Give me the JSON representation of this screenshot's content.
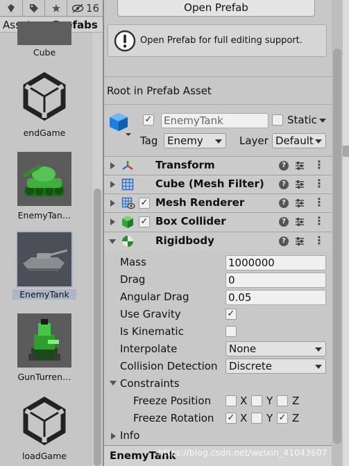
{
  "toolbar": {
    "icons": [
      "scene-icon",
      "tag-icon",
      "star-icon",
      "eye-hidden-icon"
    ],
    "hidden_count": "16"
  },
  "breadcrumb": {
    "root": "Assets",
    "separator": "▸",
    "current": "Prefabs"
  },
  "assets": [
    {
      "label": "Cube",
      "icon": "cube-thumbnail"
    },
    {
      "label": "endGame",
      "icon": "unity-logo-icon"
    },
    {
      "label": "EnemyTan…",
      "icon": "green-tank-thumbnail"
    },
    {
      "label": "EnemyTank",
      "icon": "gray-tank-thumbnail",
      "selected": true
    },
    {
      "label": "GunTurren…",
      "icon": "gun-turret-thumbnail"
    },
    {
      "label": "loadGame",
      "icon": "unity-logo-icon"
    }
  ],
  "inspector": {
    "open_prefab_label": "Open Prefab",
    "help_text": "Open Prefab for full editing support.",
    "section_title": "Root in Prefab Asset",
    "object": {
      "active": true,
      "name": "EnemyTank",
      "static_label": "Static",
      "tag_label": "Tag",
      "tag_value": "Enemy",
      "layer_label": "Layer",
      "layer_value": "Default"
    },
    "components": [
      {
        "name": "Transform",
        "icon": "transform-icon",
        "has_toggle": false,
        "expanded": false
      },
      {
        "name": "Cube (Mesh Filter)",
        "icon": "mesh-filter-icon",
        "has_toggle": false,
        "expanded": false
      },
      {
        "name": "Mesh Renderer",
        "icon": "mesh-renderer-icon",
        "has_toggle": true,
        "expanded": false
      },
      {
        "name": "Box Collider",
        "icon": "box-collider-icon",
        "has_toggle": true,
        "expanded": false
      },
      {
        "name": "Rigidbody",
        "icon": "rigidbody-icon",
        "has_toggle": false,
        "expanded": true
      }
    ],
    "rigidbody": {
      "mass_label": "Mass",
      "mass": "1000000",
      "drag_label": "Drag",
      "drag": "0",
      "angular_drag_label": "Angular Drag",
      "angular_drag": "0.05",
      "use_gravity_label": "Use Gravity",
      "use_gravity": true,
      "is_kinematic_label": "Is Kinematic",
      "is_kinematic": false,
      "interpolate_label": "Interpolate",
      "interpolate": "None",
      "collision_label": "Collision Detection",
      "collision": "Discrete",
      "constraints_label": "Constraints",
      "freeze_position_label": "Freeze Position",
      "freeze_position": {
        "X": false,
        "Y": false,
        "Z": false
      },
      "freeze_rotation_label": "Freeze Rotation",
      "freeze_rotation": {
        "X": true,
        "Y": false,
        "Z": true
      },
      "axis_x": "X",
      "axis_y": "Y",
      "axis_z": "Z"
    },
    "info_label": "Info",
    "footer_name": "EnemyTank"
  },
  "watermark": "https://blog.csdn.net/weixin_41043607",
  "colors": {
    "panel_bg": "#c8c8c8",
    "header_bg": "#cbcbcb",
    "selected_asset_bg": "#a9b7c9",
    "transform_accent": "#e0312b"
  }
}
